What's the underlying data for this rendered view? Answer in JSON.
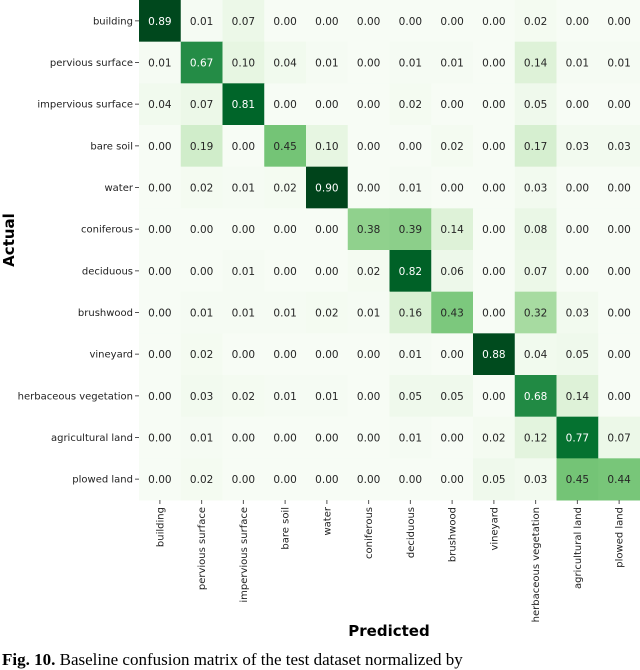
{
  "chart_data": {
    "type": "heatmap",
    "title": "",
    "xlabel": "Predicted",
    "ylabel": "Actual",
    "colormap": "Greens",
    "value_range": [
      0,
      1
    ],
    "row_labels": [
      "building",
      "pervious surface",
      "impervious surface",
      "bare soil",
      "water",
      "coniferous",
      "deciduous",
      "brushwood",
      "vineyard",
      "herbaceous vegetation",
      "agricultural land",
      "plowed land"
    ],
    "col_labels": [
      "building",
      "pervious surface",
      "impervious surface",
      "bare soil",
      "water",
      "coniferous",
      "deciduous",
      "brushwood",
      "vineyard",
      "herbaceous vegetation",
      "agricultural land",
      "plowed land"
    ],
    "values": [
      [
        0.89,
        0.01,
        0.07,
        0.0,
        0.0,
        0.0,
        0.0,
        0.0,
        0.0,
        0.02,
        0.0,
        0.0
      ],
      [
        0.01,
        0.67,
        0.1,
        0.04,
        0.01,
        0.0,
        0.01,
        0.01,
        0.0,
        0.14,
        0.01,
        0.01
      ],
      [
        0.04,
        0.07,
        0.81,
        0.0,
        0.0,
        0.0,
        0.02,
        0.0,
        0.0,
        0.05,
        0.0,
        0.0
      ],
      [
        0.0,
        0.19,
        0.0,
        0.45,
        0.1,
        0.0,
        0.0,
        0.02,
        0.0,
        0.17,
        0.03,
        0.03
      ],
      [
        0.0,
        0.02,
        0.01,
        0.02,
        0.9,
        0.0,
        0.01,
        0.0,
        0.0,
        0.03,
        0.0,
        0.0
      ],
      [
        0.0,
        0.0,
        0.0,
        0.0,
        0.0,
        0.38,
        0.39,
        0.14,
        0.0,
        0.08,
        0.0,
        0.0
      ],
      [
        0.0,
        0.0,
        0.01,
        0.0,
        0.0,
        0.02,
        0.82,
        0.06,
        0.0,
        0.07,
        0.0,
        0.0
      ],
      [
        0.0,
        0.01,
        0.01,
        0.01,
        0.02,
        0.01,
        0.16,
        0.43,
        0.0,
        0.32,
        0.03,
        0.0
      ],
      [
        0.0,
        0.02,
        0.0,
        0.0,
        0.0,
        0.0,
        0.01,
        0.0,
        0.88,
        0.04,
        0.05,
        0.0
      ],
      [
        0.0,
        0.03,
        0.02,
        0.01,
        0.01,
        0.0,
        0.05,
        0.05,
        0.0,
        0.68,
        0.14,
        0.0
      ],
      [
        0.0,
        0.01,
        0.0,
        0.0,
        0.0,
        0.0,
        0.01,
        0.0,
        0.02,
        0.12,
        0.77,
        0.07
      ],
      [
        0.0,
        0.02,
        0.0,
        0.0,
        0.0,
        0.0,
        0.0,
        0.0,
        0.05,
        0.03,
        0.45,
        0.44
      ]
    ],
    "grid": false,
    "legend": "none"
  },
  "caption": {
    "label": "Fig. 10.",
    "text": "Baseline confusion matrix of the test dataset normalized by"
  }
}
